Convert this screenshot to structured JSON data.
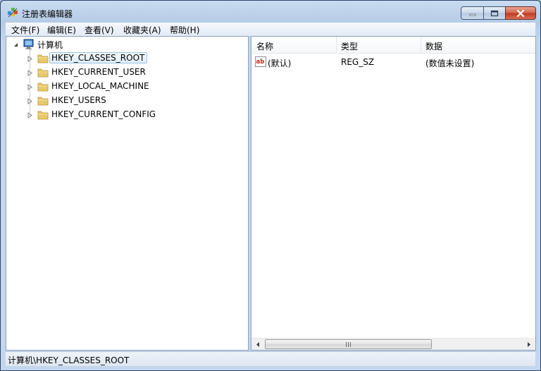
{
  "window": {
    "title": "注册表编辑器"
  },
  "menu": [
    "文件(F)",
    "编辑(E)",
    "查看(V)",
    "收藏夹(A)",
    "帮助(H)"
  ],
  "tree": {
    "root": "计算机",
    "keys": [
      "HKEY_CLASSES_ROOT",
      "HKEY_CURRENT_USER",
      "HKEY_LOCAL_MACHINE",
      "HKEY_USERS",
      "HKEY_CURRENT_CONFIG"
    ],
    "selected": "HKEY_CLASSES_ROOT"
  },
  "list": {
    "columns": [
      "名称",
      "类型",
      "数据"
    ],
    "rows": [
      {
        "name": "(默认)",
        "type": "REG_SZ",
        "data": "(数值未设置)"
      }
    ]
  },
  "status": {
    "path": "计算机\\HKEY_CLASSES_ROOT"
  },
  "colors": {
    "selection_border": "#9cc4ea",
    "folder": "#e8c96a",
    "close": "#c0391f"
  }
}
